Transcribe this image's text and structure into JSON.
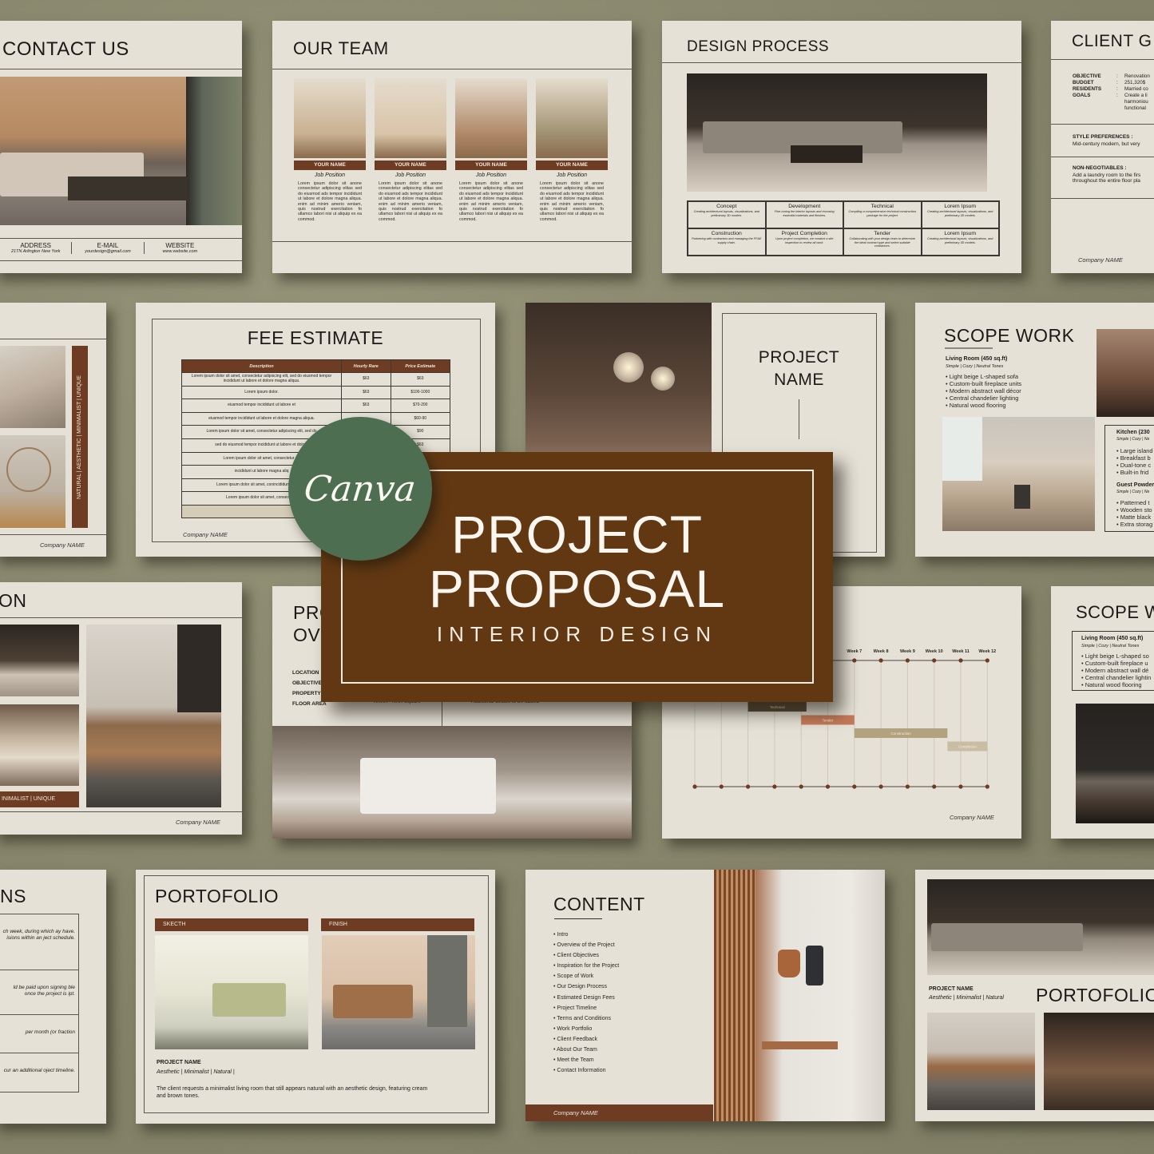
{
  "contact": {
    "title": "CONTACT US",
    "fields": [
      {
        "label": "ADDRESS",
        "value": "21TN Arlington New York"
      },
      {
        "label": "E-MAIL",
        "value": "yourdesign@gmail.com"
      },
      {
        "label": "WEBSITE",
        "value": "www.website.com"
      }
    ]
  },
  "team": {
    "title": "OUR TEAM",
    "members": [
      {
        "name": "YOUR NAME",
        "position": "Job Position",
        "bio": "Lorem ipsum dolor sit anone consectetur adipiscing elitas sed do eiusmod ads tempor incididunt ut labore et dolore magna aliqua. enim ad minim amerio veniam, quis nostrud exercitation fo ullamco labori nisi ut aliquip ex ea commod."
      },
      {
        "name": "YOUR NAME",
        "position": "Job Position",
        "bio": "Lorem ipsum dolor sit anone consectetur adipiscing elitas sed do eiusmod ads tempor incididunt ut labore et dolore magna aliqua. enim ad minim amerio veniam, quis nostrud exercitation fo ullamco labori nisi ut aliquip ex ea commod."
      },
      {
        "name": "YOUR NAME",
        "position": "Job Position",
        "bio": "Lorem ipsum dolor sit anone consectetur adipiscing elitas sed do eiusmod ads tempor incididunt ut labore et dolore magna aliqua. enim ad minim amerio veniam, quis nostrud exercitation fo ullamco labori nisi ut aliquip ex ea commod."
      },
      {
        "name": "YOUR NAME",
        "position": "Job Position",
        "bio": "Lorem ipsum dolor sit anone consectetur adipiscing elitas sed do eiusmod ads tempor incididunt ut labore et dolore magna aliqua. enim ad minim amerio veniam, quis nostrud exercitation fo ullamco labori nisi ut aliquip ex ea commod."
      }
    ]
  },
  "process": {
    "title": "DESIGN PROCESS",
    "steps": [
      {
        "name": "Concept",
        "desc": "Creating architectural layouts, visualizations, and preliminary 3D models."
      },
      {
        "name": "Development",
        "desc": "Fine-tuning the interior layouts and choosing essential materials and finishes."
      },
      {
        "name": "Technical",
        "desc": "Compiling a comprehensive technical construction package for the project"
      },
      {
        "name": "Lorem Ipsum",
        "desc": "Creating architectural layouts, visualizations, and preliminary 3D models."
      },
      {
        "name": "Construction",
        "desc": "Partnering with contractors and managing the FF&E supply chain."
      },
      {
        "name": "Project Completion",
        "desc": "Upon project completion, we conduct a site inspection to review all work."
      },
      {
        "name": "Tender",
        "desc": "Collaborating with your design team to determine the ideal contract type and select suitable contractors."
      },
      {
        "name": "Lorem Ipsum",
        "desc": "Creating architectural layouts, visualizations, and preliminary 3D models."
      }
    ]
  },
  "client": {
    "title": "CLIENT G",
    "rows": [
      {
        "k": "OBJECTIVE",
        "v": "Renovation"
      },
      {
        "k": "BUDGET",
        "v": "251,320$"
      },
      {
        "k": "RESIDENTS",
        "v": "Married co"
      },
      {
        "k": "GOALS",
        "v": "Create a li harmoniou functional"
      }
    ],
    "style_label": "STYLE PREFERENCES :",
    "style_text": "Mid-century modern, but very",
    "nn_label": "NON-NEGOTIABLES :",
    "nn_text": "Add a laundry room to the firs throughout the entire floor pla",
    "company": "Company NAME"
  },
  "moodboard": {
    "tags": "NATURAL | AESTHETIC | MINIMALIST | UNIQUE",
    "company": "Company NAME"
  },
  "fee": {
    "title": "FEE ESTIMATE",
    "headers": [
      "Description",
      "Hourly Rare",
      "Price Estimate"
    ],
    "rows": [
      [
        "Lorem ipsum dolor sit amet, consectetur adipiscing elit, sed do eiusmod tempor incididunt ut labore et dolore magna aliqua.",
        "$63",
        "$63"
      ],
      [
        "Lorem ipsum dolor.",
        "$63",
        "$100-1000"
      ],
      [
        "eiusmod tempor incididunt ut labore et",
        "$63",
        "$70-200"
      ],
      [
        "eiusmod tempor incididunt ut labore et dolore magna aliqua.",
        "",
        "$60-90"
      ],
      [
        "Lorem ipsum dolor sit amet, consectetur adipiscing elit, sed do",
        "",
        "$90"
      ],
      [
        "sed do eiusmod tempor incididunt ut labore et dolore",
        "",
        "$63"
      ],
      [
        "Lorem ipsum dolor sit amet, consectetur ad",
        "",
        ""
      ],
      [
        "incididunt ut labore magna aliq",
        "",
        ""
      ],
      [
        "Lorem ipsum dolor sit amet, conincididunt ut labore",
        "",
        ""
      ],
      [
        "Lorem ipsum dolor sit amet, consectetur",
        "",
        ""
      ]
    ],
    "total": "Total",
    "company": "Company NAME"
  },
  "cover_name": {
    "title": "PROJECT NAME"
  },
  "scope": {
    "title": "SCOPE WORK",
    "living": {
      "title": "Living Room (450 sq.ft)",
      "tags": "Simple | Cozy | Neutral Tones",
      "items": [
        "Light beige L-shaped sofa",
        "Custom-built fireplace units",
        "Modern abstract wall décor",
        "Central chandelier lighting",
        "Natural wood flooring"
      ]
    },
    "kitchen": {
      "title": "Kitchen (230",
      "tags": "Simple | Cozy | Ne",
      "items": [
        "Large island",
        "Breakfast b",
        "Dual-tone c",
        "Built-in frid"
      ]
    },
    "powder": {
      "title": "Guest Powder",
      "tags": "Simple | Cozy | Ne",
      "items": [
        "Patterned t",
        "Wooden sto",
        "Matte black",
        "Extra storag"
      ]
    }
  },
  "inspiration": {
    "title": "ON",
    "tags": "INIMALIST | UNIQUE",
    "company": "Company NAME"
  },
  "overview": {
    "title_1": "PRO",
    "title_2": "OV",
    "rows": [
      "LOCATION",
      "OBJECTIVE",
      "PROPERTY",
      "FLOOR AREA"
    ],
    "floor_value": "XXXX - XXX Square",
    "extra": "Additional details to be added"
  },
  "timeline": {
    "weeks": [
      "Week 7",
      "Week 8",
      "Week 9",
      "Week 10",
      "Week 11",
      "Week 12"
    ],
    "bars": [
      {
        "label": "Technical",
        "start": 3,
        "end": 5.2,
        "color": "#5a4a36"
      },
      {
        "label": "Tender",
        "start": 5,
        "end": 7,
        "color": "#c47a5a"
      },
      {
        "label": "Construction",
        "start": 7,
        "end": 10.5,
        "color": "#b2a27e"
      },
      {
        "label": "Completion",
        "start": 10.5,
        "end": 12,
        "color": "#c9bda3"
      }
    ],
    "company": "Company NAME"
  },
  "scope2": {
    "title": "SCOPE W",
    "living": {
      "title": "Living Room (450 sq.ft)",
      "tags": "Simple | Cozy | Neutral Tones",
      "items": [
        "Light beige L-shaped so",
        "Custom-built fireplace u",
        "Modern abstract wall dé",
        "Central chandelier lightin",
        "Natural wood flooring"
      ]
    }
  },
  "terms": {
    "title": "NS",
    "blocks": [
      "ch week, during which ay have. isions within an ject schedule.",
      "ld be paid upon signing ble once the project is ipt.",
      "per month (or fraction",
      "cur an additional oject timeline."
    ]
  },
  "portfolio": {
    "title": "PORTOFOLIO",
    "sketch": "SKECTH",
    "finish": "FINISH",
    "project": "PROJECT NAME",
    "tags": "Aesthetic | Minimalist | Natural |",
    "desc": "The client requests a minimalist living room that still appears natural with an aesthetic design, featuring cream and brown tones."
  },
  "content": {
    "title": "CONTENT",
    "items": [
      "Intro",
      "Overview of the Project",
      "Client Objectives",
      "Inspiration for the Project",
      "Scope of Work",
      "Our Design Process",
      "Estimated Design Fees",
      "Project Timeline",
      "Terms and Conditions",
      "Work Portfolio",
      "Client Feedback",
      "About Our Team",
      "Meet the Team",
      "Contact Information"
    ],
    "company": "Company NAME"
  },
  "portfolio2": {
    "title": "PORTOFOLIO",
    "project": "PROJECT NAME",
    "tags": "Aesthetic | Minimalist | Natural"
  },
  "hero": {
    "line1": "PROJECT",
    "line2": "PROPOSAL",
    "subtitle": "INTERIOR DESIGN",
    "badge": "Canva",
    "colors": {
      "brown": "#623813",
      "green": "#4e6e51"
    }
  }
}
